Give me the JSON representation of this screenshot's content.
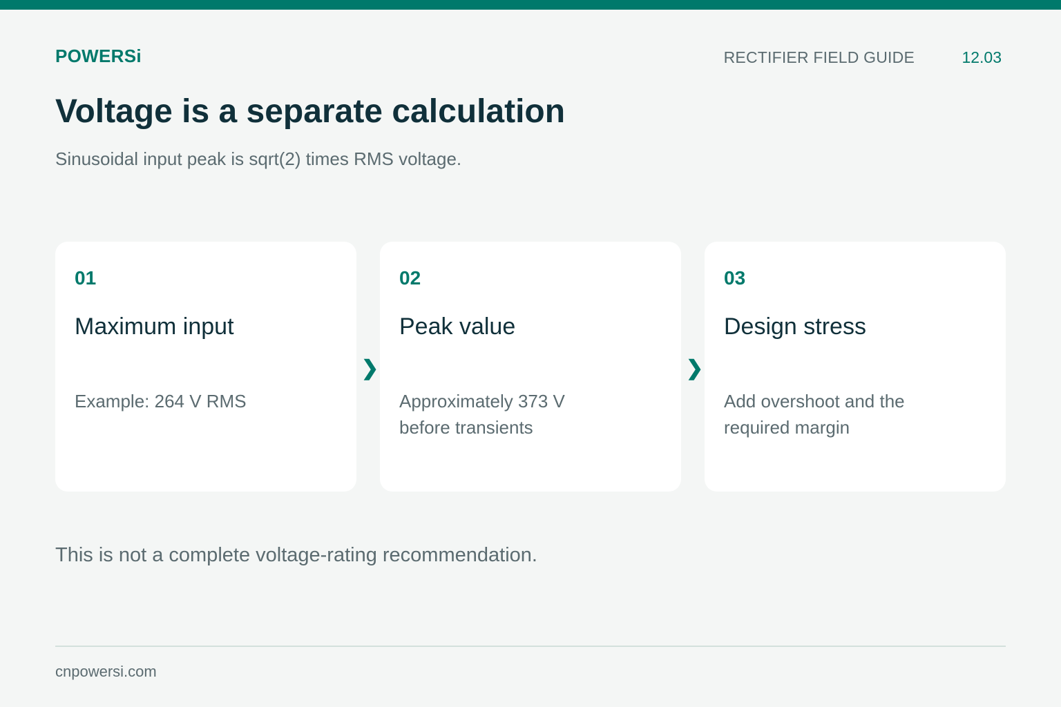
{
  "header": {
    "brand": "POWERSi",
    "guide_title": "RECTIFIER FIELD GUIDE",
    "page_number": "12.03"
  },
  "main": {
    "title": "Voltage is a separate calculation",
    "subtitle": "Sinusoidal input peak is sqrt(2) times RMS voltage.",
    "steps": [
      {
        "number": "01",
        "title": "Maximum input",
        "description": "Example: 264 V RMS"
      },
      {
        "number": "02",
        "title": "Peak value",
        "description": "Approximately 373 V before transients"
      },
      {
        "number": "03",
        "title": "Design stress",
        "description": "Add overshoot and the required margin"
      }
    ],
    "arrow_glyph": "❯",
    "note": "This is not a complete voltage-rating recommendation."
  },
  "footer": {
    "url": "cnpowersi.com"
  },
  "colors": {
    "accent": "#00796b",
    "heading": "#10303a",
    "body_text": "#5b6b70",
    "background": "#f4f6f5",
    "card": "#ffffff"
  }
}
